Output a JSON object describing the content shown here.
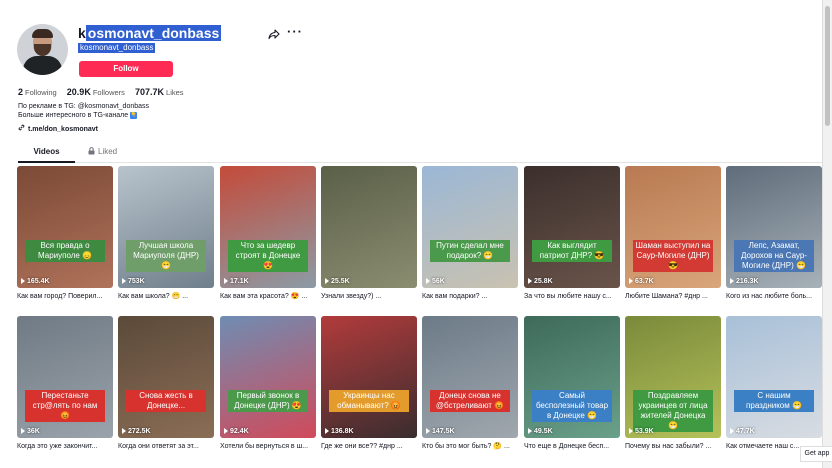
{
  "profile": {
    "username": "kosmonavt_donbass",
    "username_first_char": "k",
    "username_rest": "osmonavt_donbass",
    "nickname": "kosmonavt_donbass",
    "follow_label": "Follow",
    "following_count": "2",
    "following_label": "Following",
    "followers_count": "20.9K",
    "followers_label": "Followers",
    "likes_count": "707.7K",
    "likes_label": "Likes",
    "bio_line1": "По рекламе в TG: @kosmonavt_donbass",
    "bio_line2": "Больше интересного в TG-канале",
    "bio_badge": "👇",
    "link": "t.me/don_kosmonavt"
  },
  "tabs": {
    "videos": "Videos",
    "liked": "Liked"
  },
  "videos": [
    {
      "views": "165.4K",
      "caption": "Как вам город? Поверил...",
      "overlay": "Вся правда о Мариуполе 😞",
      "colors": [
        "#7b4a36",
        "#b0725a"
      ],
      "tag": "#3f8a41"
    },
    {
      "views": "753K",
      "caption": "Как вам школа? 😁 ...",
      "overlay": "Лучшая школа Мариуполя (ДНР) 😁",
      "colors": [
        "#b8c3cc",
        "#6f7f8b"
      ],
      "tag": "#6f9e6a"
    },
    {
      "views": "17.1K",
      "caption": "Как вам эта красота? 😍 ...",
      "overlay": "Что за шедевр строят в Донецке 😍",
      "colors": [
        "#c44b3a",
        "#8c9ba6"
      ],
      "tag": "#3f9a41"
    },
    {
      "views": "25.5K",
      "caption": "Узнали звезду?) ...",
      "overlay": "",
      "colors": [
        "#5a5f48",
        "#8b8d70"
      ],
      "tag": "#3f9a41"
    },
    {
      "views": "56K",
      "caption": "Как вам подарки? ...",
      "overlay": "Путин сделал мне подарок? 😁",
      "colors": [
        "#9bb7d6",
        "#c9c2b0"
      ],
      "tag": "#4b9a4b"
    },
    {
      "views": "25.8K",
      "caption": "За что вы любите нашу с...",
      "overlay": "Как выглядит патриот ДНР? 😎",
      "colors": [
        "#3b2f2c",
        "#6a544a"
      ],
      "tag": "#3f9a41"
    },
    {
      "views": "63.7K",
      "caption": "Любите Шамана? #днр ...",
      "overlay": "Шаман выступил на Саур-Могиле (ДНР) 😎",
      "colors": [
        "#b87a52",
        "#d9a57a"
      ],
      "tag": "#d23a33"
    },
    {
      "views": "216.3K",
      "caption": "Кого из нас любите боль...",
      "overlay": "Лепс, Азамат, Дорохов на Саур-Могиле (ДНР) 😁",
      "colors": [
        "#5f6c7a",
        "#a7b1b8"
      ],
      "tag": "#4b78b5"
    },
    {
      "views": "36K",
      "caption": "Когда это уже закончит...",
      "overlay": "Перестаньте стр@лять по нам 😡",
      "colors": [
        "#707a84",
        "#9aa3ab"
      ],
      "tag": "#d7322e"
    },
    {
      "views": "272.5K",
      "caption": "Когда они ответят за эт...",
      "overlay": "Снова жесть в Донецке...",
      "colors": [
        "#5b4a3a",
        "#8b6d55"
      ],
      "tag": "#d7322e"
    },
    {
      "views": "92.4K",
      "caption": "Хотели бы вернуться в ш...",
      "overlay": "Первый звонок в Донецке (ДНР) 😍",
      "colors": [
        "#6f8db3",
        "#d14a5a"
      ],
      "tag": "#4b9a4b"
    },
    {
      "views": "136.8K",
      "caption": "Где же они все?? #днр ...",
      "overlay": "Украинцы нас обманывают? 😡",
      "colors": [
        "#b23b3b",
        "#3a2d2f"
      ],
      "tag": "#e39b2b"
    },
    {
      "views": "147.5K",
      "caption": "Кто бы это мог быть? 🤔 ...",
      "overlay": "Донецк снова не @бстреливают 😡",
      "colors": [
        "#6c7b88",
        "#a0a7ae"
      ],
      "tag": "#d7322e"
    },
    {
      "views": "49.5K",
      "caption": "Что еще в Донецке бесп...",
      "overlay": "Самый бесполезный товар в Донецке 😁",
      "colors": [
        "#3e6a5a",
        "#6aa08a"
      ],
      "tag": "#3b7fc4"
    },
    {
      "views": "53.9K",
      "caption": "Почему вы нас забыли? ...",
      "overlay": "Поздравляем украинцев от лица жителей Донецка 😁",
      "colors": [
        "#7a8a3a",
        "#b5c15a"
      ],
      "tag": "#3f9a41"
    },
    {
      "views": "47.7K",
      "caption": "Как отмечаете наш с...",
      "overlay": "С нашим праздником 😁",
      "colors": [
        "#a8c0d8",
        "#d8dce2"
      ],
      "tag": "#3b7fc4"
    }
  ],
  "get_app": "Get app"
}
